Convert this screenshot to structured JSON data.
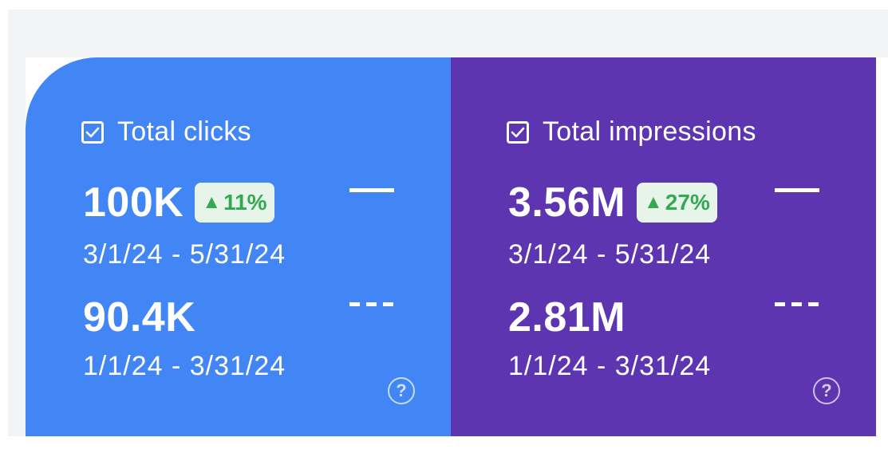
{
  "metrics": [
    {
      "label": "Total clicks",
      "checked": true,
      "color": "#4285f4",
      "current_value": "100K",
      "change_arrow": "▲",
      "change_percent": "11%",
      "current_range": "3/1/24 - 5/31/24",
      "previous_value": "90.4K",
      "previous_range": "1/1/24 - 3/31/24",
      "help_icon": "?"
    },
    {
      "label": "Total impressions",
      "checked": true,
      "color": "#5e35b1",
      "current_value": "3.56M",
      "change_arrow": "▲",
      "change_percent": "27%",
      "current_range": "3/1/24 - 5/31/24",
      "previous_value": "2.81M",
      "previous_range": "1/1/24 - 3/31/24",
      "help_icon": "?"
    }
  ],
  "colors": {
    "clicks_card": "#4285f4",
    "impressions_card": "#5e35b1",
    "badge_background": "#e6f4ea",
    "badge_text": "#34a853",
    "page_background": "#f1f3f4"
  }
}
